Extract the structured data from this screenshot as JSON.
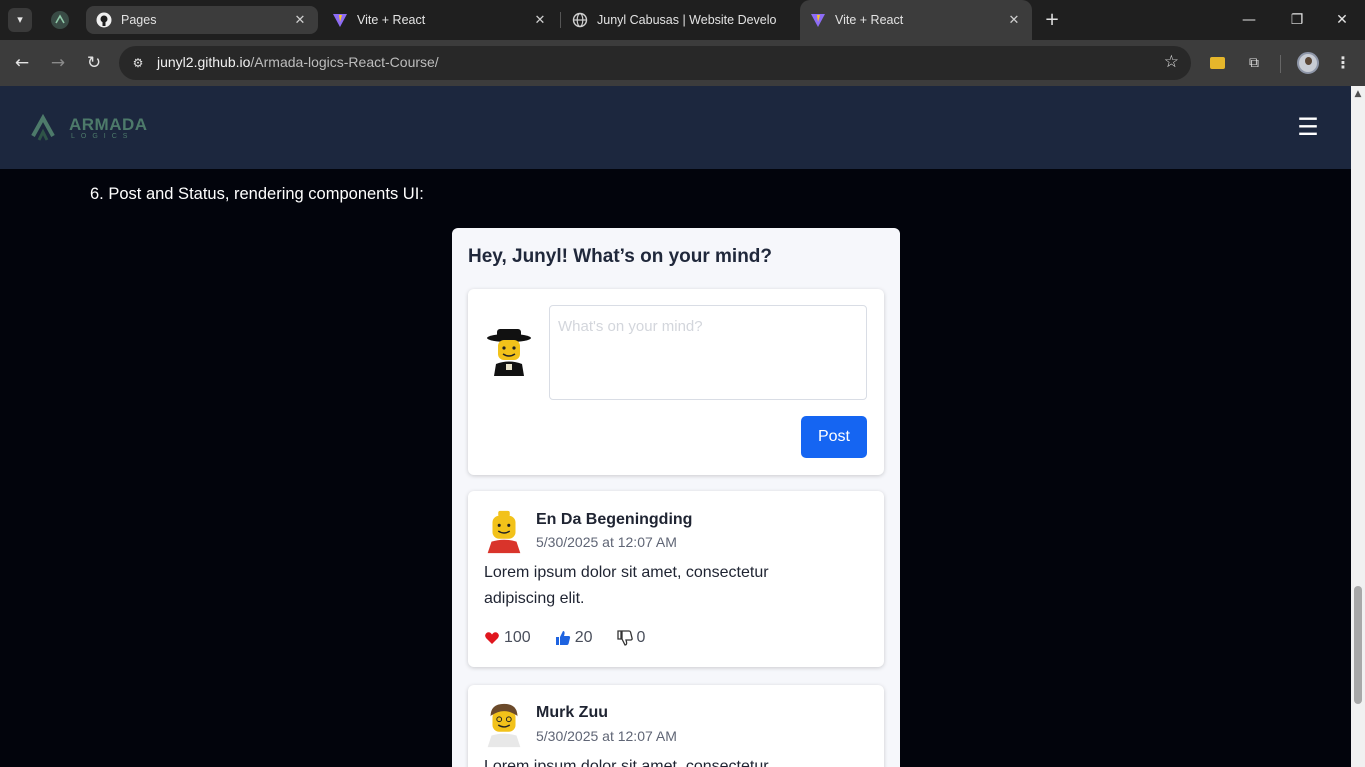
{
  "browser": {
    "tabs": [
      {
        "title": "Pages",
        "icon": "github-icon"
      },
      {
        "title": "Vite + React",
        "icon": "vite-icon"
      },
      {
        "title": "Junyl Cabusas | Website Develo",
        "icon": "globe-icon"
      },
      {
        "title": "Vite + React",
        "icon": "vite-icon"
      }
    ],
    "active_tab": 3,
    "url_host": "junyl2.github.io",
    "url_path": "/Armada-logics-React-Course/"
  },
  "site": {
    "logo_text": "ARMADA",
    "logo_sub": "LOGICS",
    "brand_color": "#4d7a6a",
    "header_color": "#1c273e"
  },
  "section": {
    "title": "6. Post and Status, rendering components UI:"
  },
  "composer": {
    "greeting": "Hey, Junyl! What’s on your mind?",
    "placeholder": "What's on your mind?",
    "post_label": "Post",
    "button_color": "#1565f2"
  },
  "posts": [
    {
      "author": "En Da Begeningding",
      "time": "5/30/2025 at 12:07 AM",
      "body": "Lorem ipsum dolor sit amet, consectetur adipiscing elit.",
      "hearts": "100",
      "likes": "20",
      "dislikes": "0"
    },
    {
      "author": "Murk Zuu",
      "time": "5/30/2025 at 12:07 AM",
      "body": "Lorem ipsum dolor sit amet, consectetur"
    }
  ]
}
